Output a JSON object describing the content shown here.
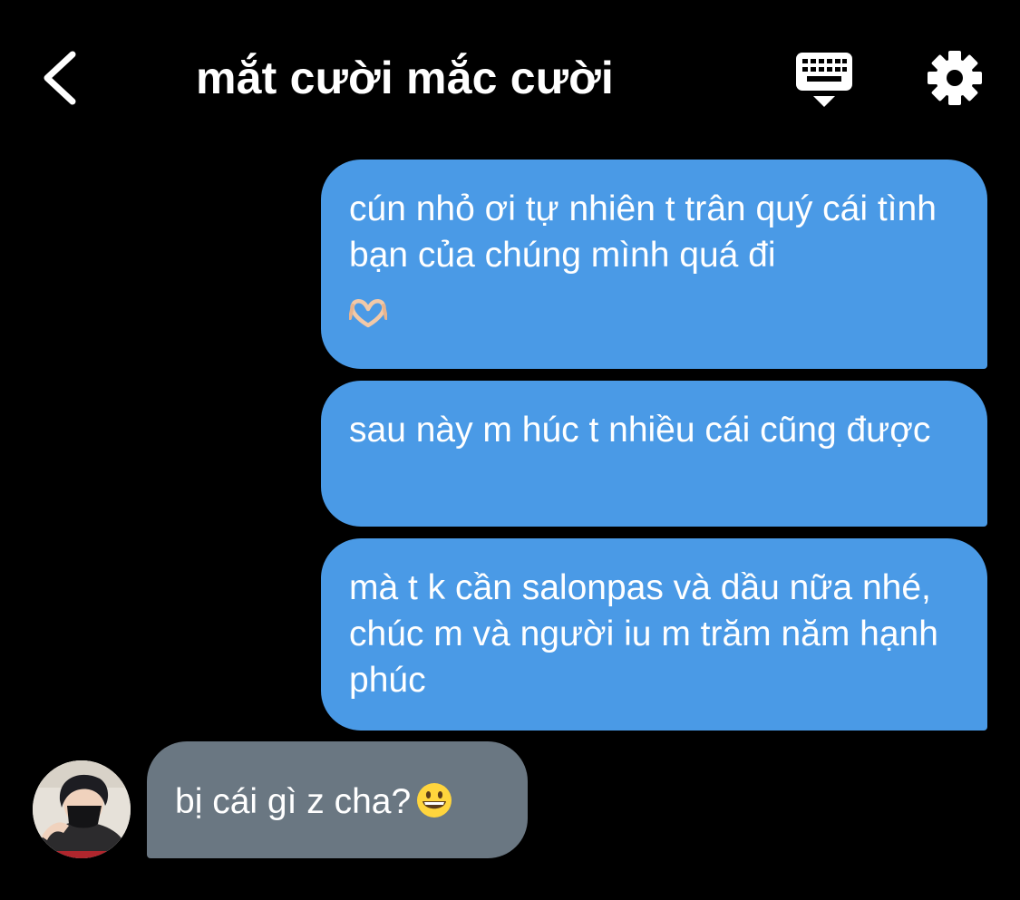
{
  "header": {
    "title": "mắt cười mắc cười",
    "back_icon": "chevron-left-icon",
    "keyboard_icon": "keyboard-icon",
    "settings_icon": "gear-icon"
  },
  "messages": [
    {
      "direction": "sent",
      "text": "cún nhỏ ơi tự nhiên t trân quý cái tình bạn của chúng mình quá đi",
      "emoji": "heart-hands-emoji"
    },
    {
      "direction": "sent",
      "text": "sau này m húc t nhiều cái cũng được"
    },
    {
      "direction": "sent",
      "text": "mà t k cần salonpas và dầu nữa nhé, chúc m và người iu m trăm năm hạnh phúc"
    },
    {
      "direction": "received",
      "text": "bị cái gì z cha?",
      "emoji": "grinning-face-emoji",
      "avatar": "sender-avatar"
    }
  ],
  "colors": {
    "background": "#000000",
    "sent_bubble": "#4a9ae6",
    "received_bubble": "#6a7782",
    "text": "#ffffff"
  }
}
